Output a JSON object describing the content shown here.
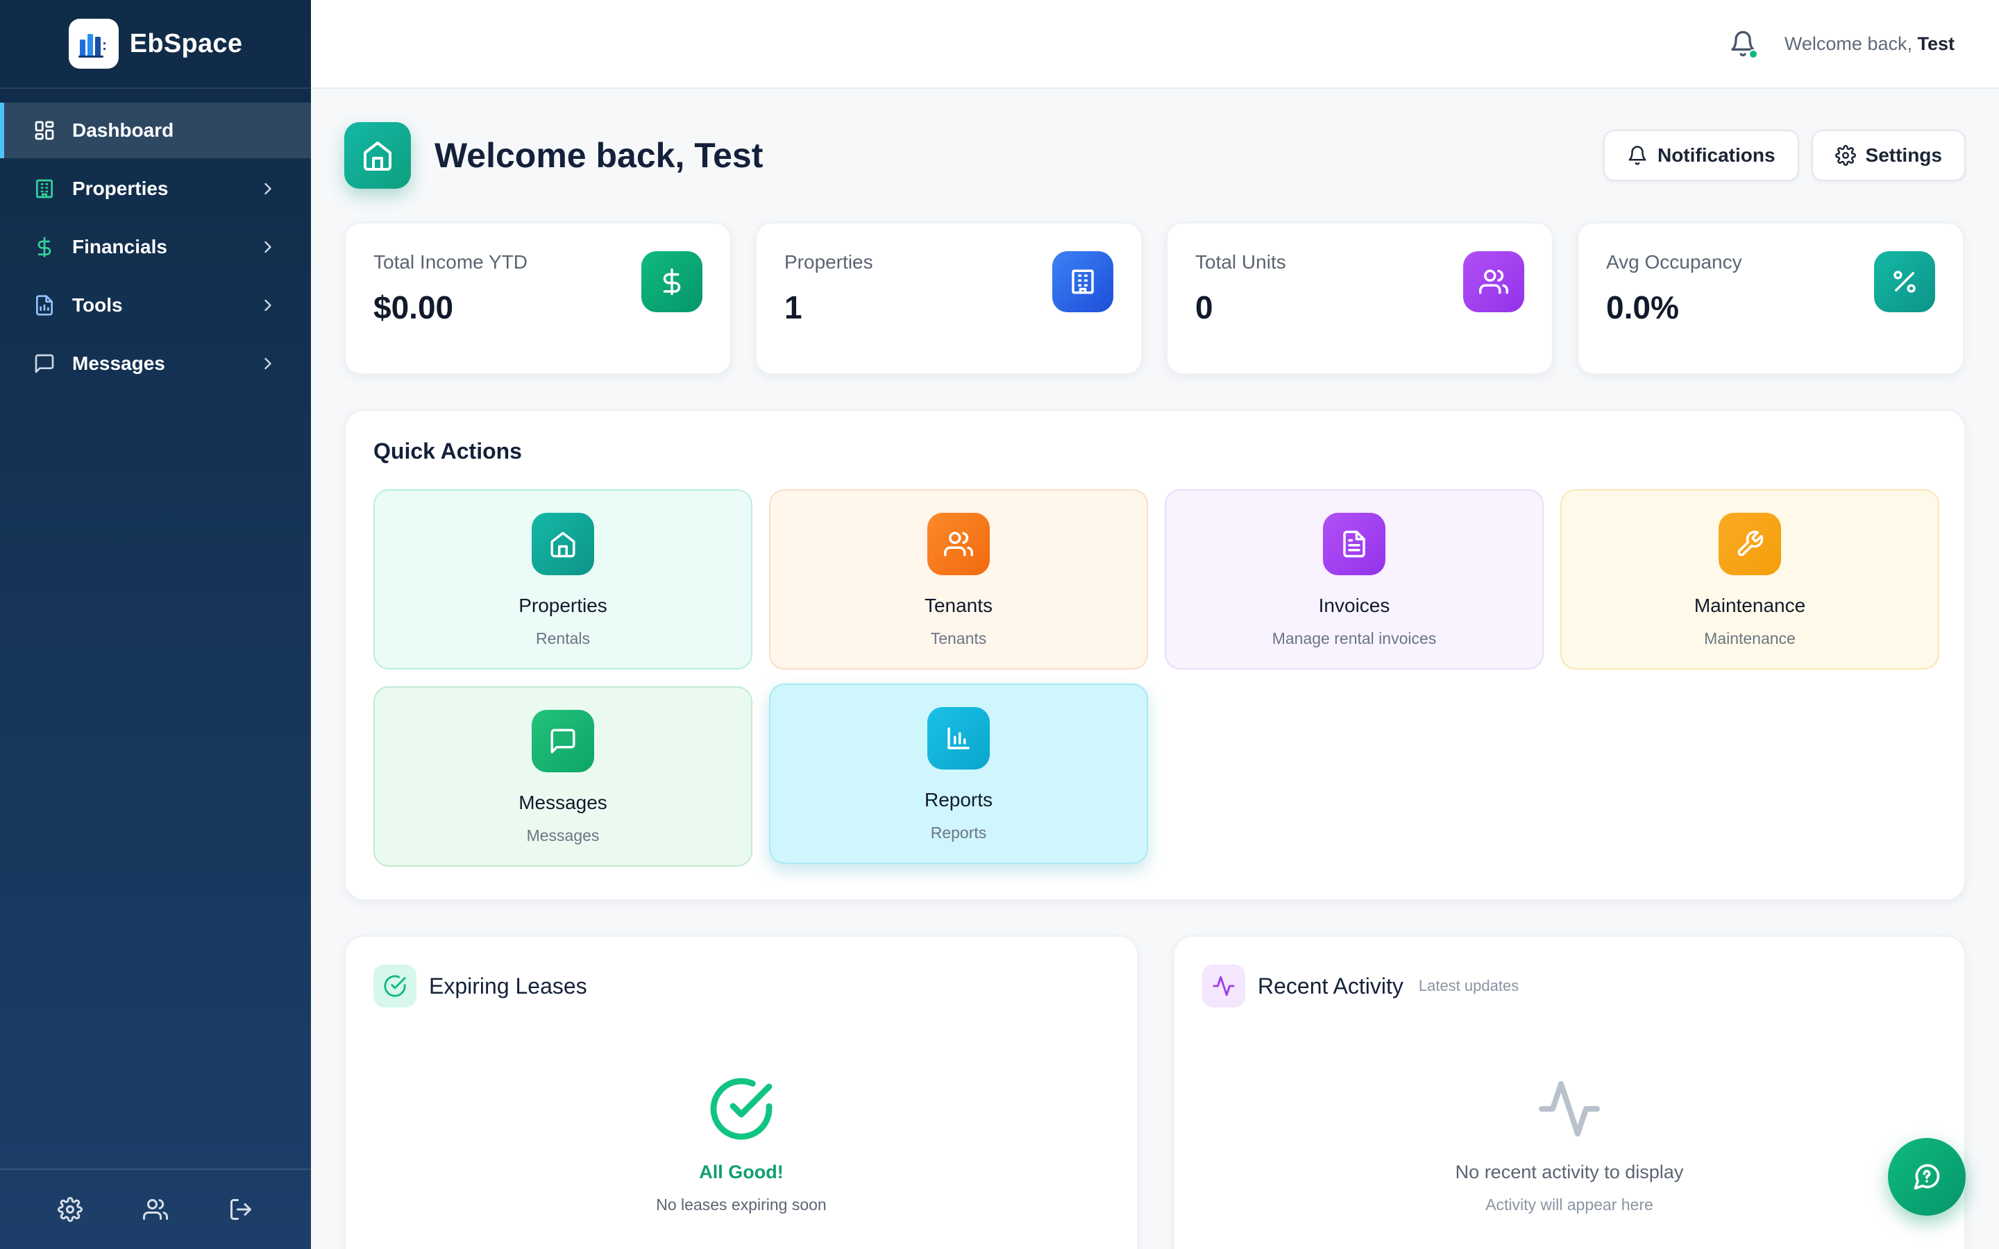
{
  "app": {
    "name": "EbSpace"
  },
  "sidebar": {
    "items": [
      {
        "label": "Dashboard",
        "icon": "dashboard-icon",
        "active": true
      },
      {
        "label": "Properties",
        "icon": "building-icon"
      },
      {
        "label": "Financials",
        "icon": "dollar-icon"
      },
      {
        "label": "Tools",
        "icon": "document-icon"
      },
      {
        "label": "Messages",
        "icon": "message-icon"
      }
    ],
    "footer": [
      "settings-icon",
      "users-icon",
      "logout-icon"
    ]
  },
  "topbar": {
    "welcome_prefix": "Welcome back,",
    "user": "Test"
  },
  "header": {
    "title": "Welcome back, Test",
    "notifications_label": "Notifications",
    "settings_label": "Settings"
  },
  "stats": [
    {
      "label": "Total Income YTD",
      "value": "$0.00",
      "icon": "dollar-icon",
      "color": "#10b981"
    },
    {
      "label": "Properties",
      "value": "1",
      "icon": "building-icon",
      "color": "#2563eb"
    },
    {
      "label": "Total Units",
      "value": "0",
      "icon": "users-icon",
      "color": "#a43ff0"
    },
    {
      "label": "Avg Occupancy",
      "value": "0.0%",
      "icon": "percent-icon",
      "color": "#14b8a6"
    }
  ],
  "quick_actions": {
    "title": "Quick Actions",
    "items": [
      {
        "title": "Properties",
        "subtitle": "Rentals",
        "icon": "home-icon",
        "color": "#14b8a6"
      },
      {
        "title": "Tenants",
        "subtitle": "Tenants",
        "icon": "users-icon",
        "color": "#f97316"
      },
      {
        "title": "Invoices",
        "subtitle": "Manage rental invoices",
        "icon": "document-icon",
        "color": "#a855f7"
      },
      {
        "title": "Maintenance",
        "subtitle": "Maintenance",
        "icon": "wrench-icon",
        "color": "#f59e0b"
      },
      {
        "title": "Messages",
        "subtitle": "Messages",
        "icon": "message-icon",
        "color": "#10b981"
      },
      {
        "title": "Reports",
        "subtitle": "Reports",
        "icon": "chart-icon",
        "color": "#06b6d4"
      }
    ]
  },
  "expiring_leases": {
    "title": "Expiring Leases",
    "empty_title": "All Good!",
    "empty_subtitle": "No leases expiring soon"
  },
  "recent_activity": {
    "title": "Recent Activity",
    "subtitle": "Latest updates",
    "empty_title": "No recent activity to display",
    "empty_subtitle": "Activity will appear here"
  }
}
